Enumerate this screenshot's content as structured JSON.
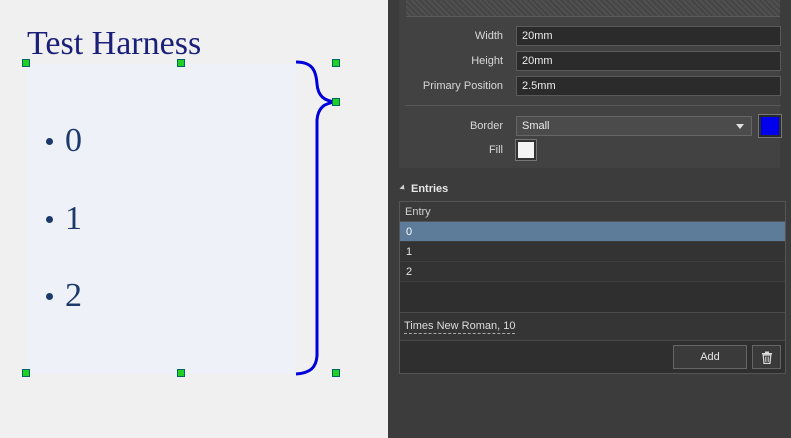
{
  "canvas": {
    "harness_title": "Test Harness",
    "entries": [
      "0",
      "1",
      "2"
    ],
    "brace_color": "#0000dd",
    "handle_color": "#22d022"
  },
  "properties": {
    "width_label": "Width",
    "width_value": "20mm",
    "height_label": "Height",
    "height_value": "20mm",
    "primary_position_label": "Primary Position",
    "primary_position_value": "2.5mm",
    "border_label": "Border",
    "border_value": "Small",
    "border_color": "#0000ee",
    "fill_label": "Fill",
    "fill_color": "#f4f4f4"
  },
  "entries_panel": {
    "section_title": "Entries",
    "column_header": "Entry",
    "rows": [
      "0",
      "1",
      "2"
    ],
    "selected_index": 0,
    "font": "Times New Roman, 10",
    "add_label": "Add",
    "delete_icon": "trash-icon"
  }
}
